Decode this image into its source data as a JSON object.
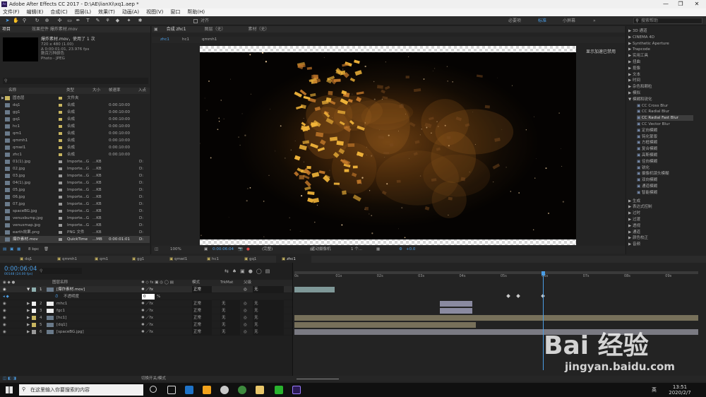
{
  "window": {
    "title": "Adobe After Effects CC 2017 - D:\\AE\\lianXi\\xq1.aep *",
    "app_icon": "Ae",
    "controls": [
      "—",
      "❐",
      "✕"
    ]
  },
  "menu": [
    "文件(F)",
    "编辑(E)",
    "合成(C)",
    "图层(L)",
    "效果(T)",
    "动画(A)",
    "视图(V)",
    "窗口",
    "帮助(H)"
  ],
  "toolbar": {
    "snap_label": "对齐",
    "workspaces": [
      "必要项",
      "标准",
      "小屏幕"
    ],
    "active_workspace": "标准",
    "search_placeholder": "搜索帮助"
  },
  "project": {
    "tab_project": "项目",
    "tab_effects": "效果控件 爆炸素材.mov",
    "selected_name": "爆炸素材.mov",
    "selected_usage": "，使用了 1 次",
    "info1": "720 x 480 (1.00)",
    "info2": "Δ 0:00:01:01, 23.976 fps",
    "info3": "数百万种颜色",
    "info4": "Photo - JPEG",
    "columns": [
      "名称",
      "类型",
      "大小",
      "帧速率",
      "入点"
    ],
    "items": [
      {
        "name": "固态层",
        "type": "文件夹",
        "size": "",
        "dur": "",
        "extra": "",
        "color": "#c8b560",
        "folder": true
      },
      {
        "name": "dq1",
        "type": "合成",
        "size": "",
        "dur": "0:00:10:00",
        "extra": "",
        "color": "#c8b560"
      },
      {
        "name": "gg1",
        "type": "合成",
        "size": "",
        "dur": "0:00:10:00",
        "extra": "",
        "color": "#c8b560"
      },
      {
        "name": "gq1",
        "type": "合成",
        "size": "",
        "dur": "0:00:10:00",
        "extra": "",
        "color": "#c8b560"
      },
      {
        "name": "hc1",
        "type": "合成",
        "size": "",
        "dur": "0:00:10:00",
        "extra": "",
        "color": "#c8b560"
      },
      {
        "name": "qm1",
        "type": "合成",
        "size": "",
        "dur": "0:00:10:00",
        "extra": "",
        "color": "#c8b560"
      },
      {
        "name": "qmmh1",
        "type": "合成",
        "size": "",
        "dur": "0:00:10:00",
        "extra": "",
        "color": "#c8b560"
      },
      {
        "name": "qmwl1",
        "type": "合成",
        "size": "",
        "dur": "0:00:10:00",
        "extra": "",
        "color": "#c8b560"
      },
      {
        "name": "zhc1",
        "type": "合成",
        "size": "",
        "dur": "0:00:10:00",
        "extra": "",
        "color": "#c8b560"
      },
      {
        "name": "01(1).jpg",
        "type": "Importe...G",
        "size": "...KB",
        "dur": "",
        "extra": "D:",
        "color": "#9a9a9a"
      },
      {
        "name": "02.jpg",
        "type": "Importe...G",
        "size": "...KB",
        "dur": "",
        "extra": "D:",
        "color": "#9a9a9a"
      },
      {
        "name": "03.jpg",
        "type": "Importe...G",
        "size": "...KB",
        "dur": "",
        "extra": "D:",
        "color": "#9a9a9a"
      },
      {
        "name": "04(1).jpg",
        "type": "Importe...G",
        "size": "...KB",
        "dur": "",
        "extra": "D:",
        "color": "#9a9a9a"
      },
      {
        "name": "05.jpg",
        "type": "Importe...G",
        "size": "...KB",
        "dur": "",
        "extra": "D:",
        "color": "#9a9a9a"
      },
      {
        "name": "06.jpg",
        "type": "Importe...G",
        "size": "...KB",
        "dur": "",
        "extra": "D:",
        "color": "#9a9a9a"
      },
      {
        "name": "07.jpg",
        "type": "Importe...G",
        "size": "...KB",
        "dur": "",
        "extra": "D:",
        "color": "#9a9a9a"
      },
      {
        "name": "spaceBG.jpg",
        "type": "Importe...G",
        "size": "...KB",
        "dur": "",
        "extra": "D:",
        "color": "#9a9a9a"
      },
      {
        "name": "venusbump.jpg",
        "type": "Importe...G",
        "size": "...KB",
        "dur": "",
        "extra": "D:",
        "color": "#9a9a9a"
      },
      {
        "name": "venusmap.jpg",
        "type": "Importe...G",
        "size": "...KB",
        "dur": "",
        "extra": "D:",
        "color": "#9a9a9a"
      },
      {
        "name": "earth效果.png",
        "type": "PNG 文件",
        "size": "...KB",
        "dur": "",
        "extra": "D:",
        "color": "#9a9a9a"
      },
      {
        "name": "爆炸素材.mov",
        "type": "QuickTime",
        "size": "...MB",
        "dur": "0:00:01:01",
        "extra": "D:",
        "color": "#9a9a9a",
        "selected": true
      }
    ],
    "bpc": "8 bpc"
  },
  "comp": {
    "tab": "合成 zhc1",
    "layer_tab": "图层（无）",
    "footage_tab": "素材（无）",
    "breadcrumbs": [
      "zhc1",
      "hc1",
      "qmmh1"
    ],
    "gpu_note": "显示加速已禁用",
    "zoom": "100%",
    "time": "0:00:06:04",
    "quality": "(完整)",
    "camera": "活动摄像机",
    "views": "1 个...",
    "exposure": "+0.0"
  },
  "effects": {
    "top": [
      "3D 通道",
      "CINEMA 4D",
      "Synthetic Aperture",
      "Trapcode",
      "实用工具",
      "扭曲",
      "抠像",
      "文本",
      "时间",
      "杂色和颗粒",
      "模拟",
      "模糊和锐化"
    ],
    "blur": [
      "CC Cross Blur",
      "CC Radial Blur",
      "CC Radial Fast Blur",
      "CC Vector Blur",
      "定向模糊",
      "钝化蒙版",
      "方框模糊",
      "复合模糊",
      "高斯模糊",
      "径向模糊",
      "锐化",
      "摄像机镜头模糊",
      "双向模糊",
      "通道模糊",
      "智能模糊"
    ],
    "selected": "CC Radial Fast Blur",
    "bottom": [
      "生成",
      "表达式控制",
      "过时",
      "过渡",
      "透视",
      "通道",
      "颜色校正",
      "音频"
    ],
    "last": "颜色校正"
  },
  "timeline": {
    "tabs": [
      "dq1",
      "qmmh1",
      "qm1",
      "gg1",
      "qmwl1",
      "hc1",
      "gq1",
      "zhc1"
    ],
    "active_tab": "zhc1",
    "current_time": "0:00:06:04",
    "fps_sub": "00148 (24.00 fps)",
    "col_name": "图层名称",
    "col_mode": "模式",
    "col_trk": "TrkMat",
    "col_parent": "父级",
    "ruler": [
      "0s",
      "01s",
      "02s",
      "03s",
      "04s",
      "05s",
      "06s",
      "07s",
      "08s",
      "09s"
    ],
    "layers": [
      {
        "num": "1",
        "name": "[爆炸素材.mov]",
        "mode": "正常",
        "trk": "",
        "parent": "无",
        "color": "#8fb0b0",
        "start": 0.0,
        "end": 0.1
      },
      {
        "num": "2",
        "name": "mhc1",
        "mode": "正常",
        "trk": "无",
        "parent": "无",
        "color": "#f0f0f0",
        "start": 0.36,
        "end": 0.44
      },
      {
        "num": "3",
        "name": "fgc1",
        "mode": "正常",
        "trk": "无",
        "parent": "无",
        "color": "#f0f0f0",
        "start": 0.36,
        "end": 0.44
      },
      {
        "num": "4",
        "name": "[hc1]",
        "mode": "正常",
        "trk": "无",
        "parent": "无",
        "color": "#c8b560",
        "start": 0.0,
        "end": 1.0
      },
      {
        "num": "5",
        "name": "[dq1]",
        "mode": "正常",
        "trk": "无",
        "parent": "无",
        "color": "#c8b560",
        "start": 0.0,
        "end": 0.45
      },
      {
        "num": "6",
        "name": "[spaceBG.jpg]",
        "mode": "正常",
        "trk": "无",
        "parent": "无",
        "color": "#9a9a9a",
        "start": 0.0,
        "end": 1.0
      }
    ],
    "opacity_label": "不透明度",
    "opacity_value": "0",
    "opacity_unit": "%",
    "playhead_fraction": 0.616,
    "switch_label": "切换开关/模式"
  },
  "taskbar": {
    "search": "在这里输入你要搜索的内容",
    "time": "13:51",
    "date": "2020/2/7",
    "lang": "英"
  },
  "watermark": {
    "logo": "Bai 经验",
    "url": "jingyan.baidu.com"
  }
}
